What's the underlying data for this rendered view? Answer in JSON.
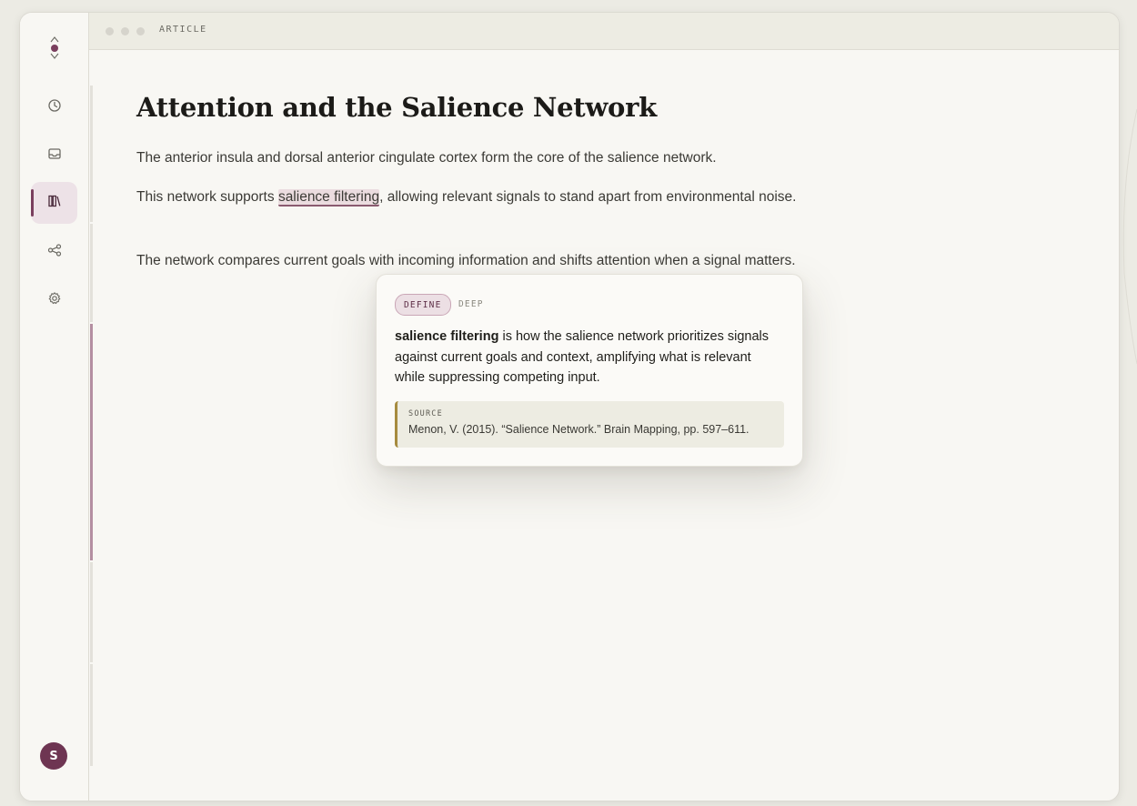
{
  "window": {
    "title": "ARTICLE"
  },
  "sidebar": {
    "logo_icon": "logo-icon",
    "items": [
      {
        "name": "history",
        "icon": "clock-icon",
        "active": false
      },
      {
        "name": "inbox",
        "icon": "inbox-icon",
        "active": false
      },
      {
        "name": "library",
        "icon": "library-icon",
        "active": true
      },
      {
        "name": "graph",
        "icon": "share-graph-icon",
        "active": false
      },
      {
        "name": "settings",
        "icon": "gear-icon",
        "active": false
      }
    ],
    "avatar_initial": "S"
  },
  "article": {
    "title": "Attention and the Salience Network",
    "p1": "The anterior insula and dorsal anterior cingulate cortex form the core of the salience network.",
    "p2_before": "This network supports ",
    "p2_highlight": "salience filtering",
    "p2_after": ", allowing relevant signals to stand apart from environmental noise.",
    "p3": "The network compares current goals with incoming information and shifts attention when a signal matters."
  },
  "popover": {
    "mode_define": "DEFINE",
    "mode_deep": "DEEP",
    "term": "salience filtering",
    "definition": " is how the salience network prioritizes signals against current goals and context, amplifying what is relevant while suppressing competing input.",
    "source_label": "SOURCE",
    "source_text": "Menon, V. (2015). “Salience Network.” Brain Mapping, pp. 597–611."
  },
  "colors": {
    "accent": "#7a3f5e",
    "avatar_bg": "#6e3552",
    "highlight_bg": "#ebdcdf",
    "source_border": "#a68b3f",
    "background": "#f8f7f3"
  }
}
